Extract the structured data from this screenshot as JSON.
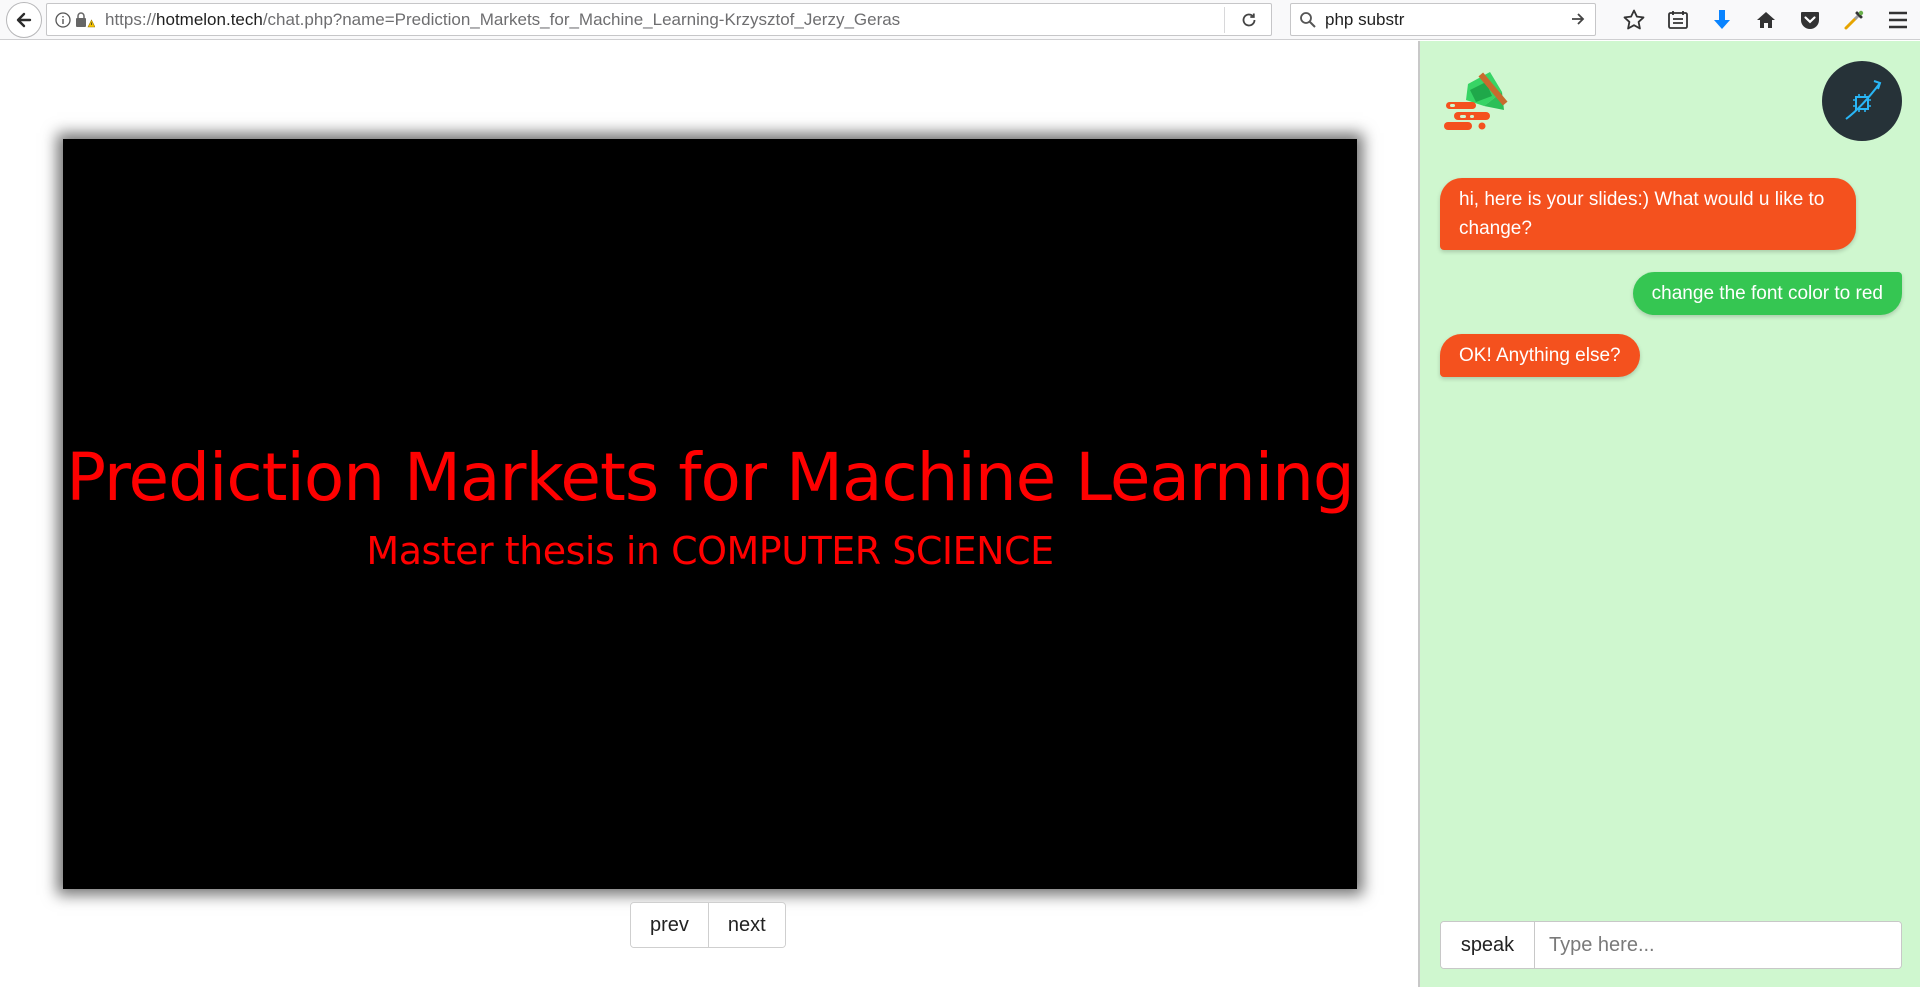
{
  "browser": {
    "url_prefix": "https://",
    "url_host": "hotmelon.tech",
    "url_path": "/chat.php?name=Prediction_Markets_for_Machine_Learning-Krzysztof_Jerzy_Geras",
    "search_text": "php substr"
  },
  "slide": {
    "title": "Prediction Markets for Machine Learning",
    "subtitle": "Master thesis in COMPUTER SCIENCE"
  },
  "pager": {
    "prev_label": "prev",
    "next_label": "next"
  },
  "chat": {
    "messages": [
      {
        "from": "bot",
        "text": "hi, here is your slides:) What would u like to change?"
      },
      {
        "from": "user",
        "text": "change the font color to red"
      },
      {
        "from": "bot",
        "text": "OK! Anything else?"
      }
    ],
    "speak_label": "speak",
    "input_placeholder": "Type here...",
    "input_value": ""
  },
  "colors": {
    "bot_bubble": "#f4511e",
    "user_bubble": "#35c652",
    "chat_bg": "#cff7cf",
    "slide_text": "#ff0000",
    "slide_bg": "#000000"
  },
  "icons": [
    "back-arrow-icon",
    "info-icon",
    "insecure-lock-icon",
    "reload-icon",
    "search-icon",
    "go-arrow-icon",
    "bookmark-star-icon",
    "reading-list-icon",
    "download-icon",
    "home-icon",
    "pocket-icon",
    "eyedropper-icon",
    "menu-icon"
  ]
}
